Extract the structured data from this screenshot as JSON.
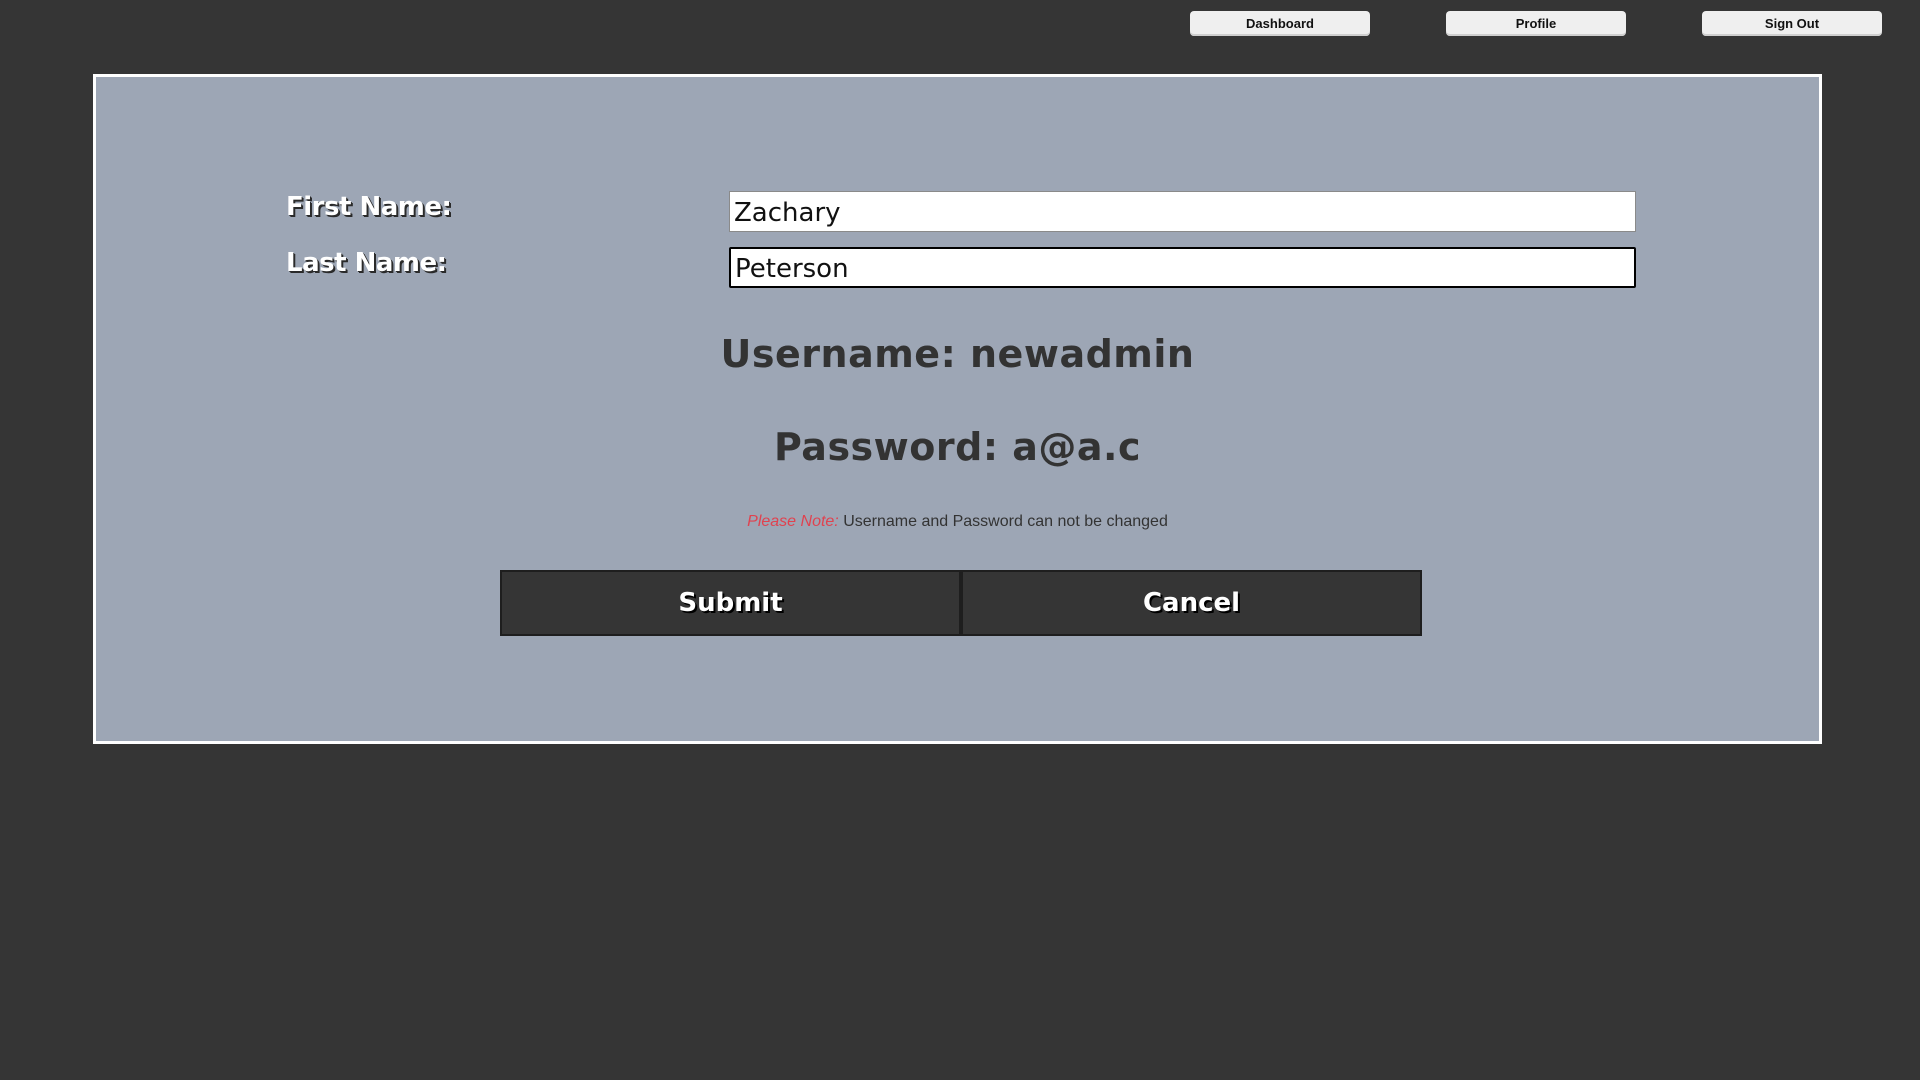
{
  "nav": {
    "dashboard_label": "Dashboard",
    "profile_label": "Profile",
    "signout_label": "Sign Out"
  },
  "form": {
    "first_name_label": "First Name:",
    "first_name_value": "Zachary",
    "last_name_label": "Last Name:",
    "last_name_value": "Peterson",
    "username_text": "Username: newadmin",
    "password_text": "Password: a@a.c",
    "note_prefix": "Please Note:",
    "note_text": " Username and Password can not be changed",
    "submit_label": "Submit",
    "cancel_label": "Cancel"
  },
  "colors": {
    "background": "#353535",
    "panel": "#9da6b5",
    "panel_border": "#ffffff",
    "note_accent": "#e0424f",
    "button": "#353535"
  }
}
